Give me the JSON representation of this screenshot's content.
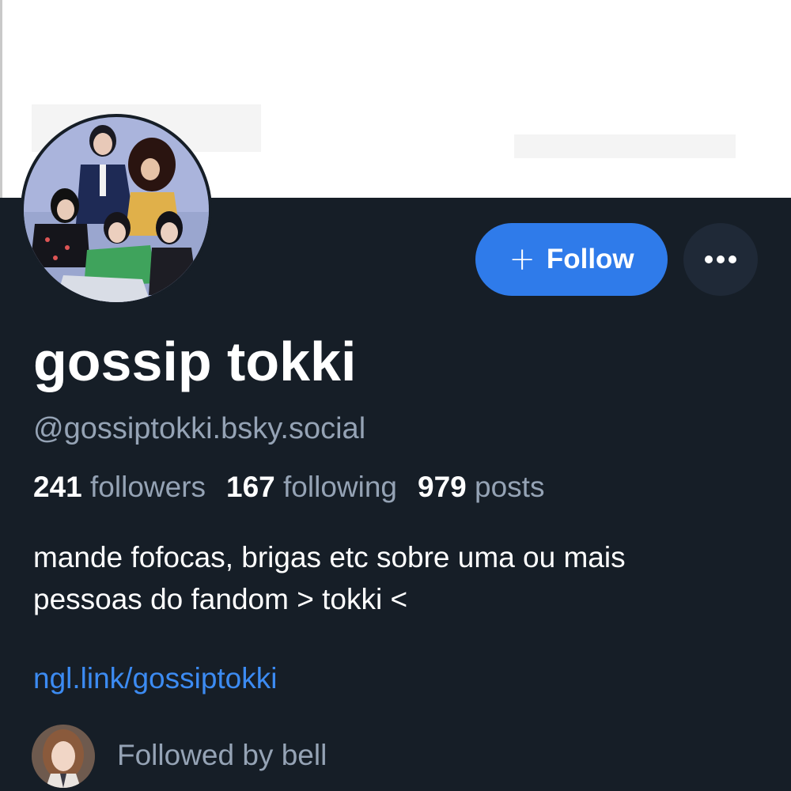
{
  "profile": {
    "display_name": "gossip tokki",
    "handle": "@gossiptokki.bsky.social",
    "stats": {
      "followers_count": "241",
      "followers_label": "followers",
      "following_count": "167",
      "following_label": "following",
      "posts_count": "979",
      "posts_label": "posts"
    },
    "bio_line1": "mande fofocas, brigas etc sobre uma ou mais",
    "bio_line2": "pessoas do fandom > tokki <",
    "link": "ngl.link/gossiptokki",
    "followed_by": "Followed by bell"
  },
  "actions": {
    "follow_icon": "plus-icon",
    "follow_label": "Follow",
    "more_icon": "ellipsis-icon"
  },
  "colors": {
    "background": "#161e27",
    "accent": "#2f7bea",
    "link": "#3c8bf2",
    "muted_text": "#95a3b5"
  }
}
